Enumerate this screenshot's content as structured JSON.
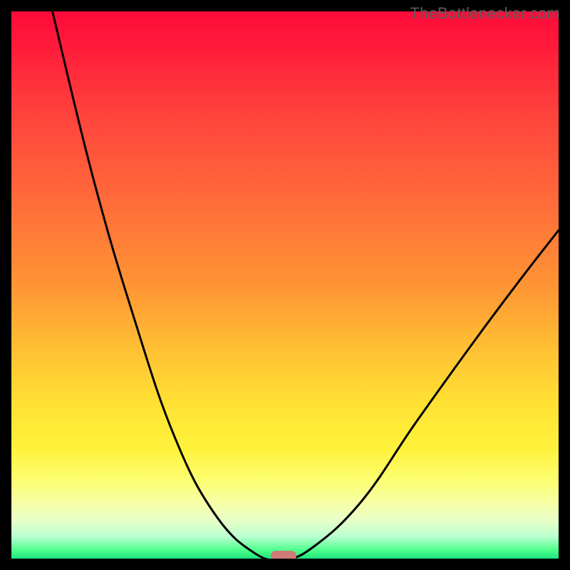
{
  "attribution": "TheBottlenecker.com",
  "chart_data": {
    "type": "line",
    "title": "",
    "xlabel": "",
    "ylabel": "",
    "xlim": [
      0,
      1
    ],
    "ylim": [
      0,
      100
    ],
    "series": [
      {
        "name": "curve-left",
        "x": [
          0.075,
          0.149,
          0.224,
          0.298,
          0.372,
          0.446,
          0.498
        ],
        "values": [
          100,
          69.7,
          44.0,
          22.3,
          8.1,
          0.9,
          0.0
        ]
      },
      {
        "name": "curve-right",
        "x": [
          0.498,
          0.55,
          0.64,
          0.74,
          0.85,
          0.93,
          1.0
        ],
        "values": [
          0.0,
          2.0,
          10.5,
          25.0,
          40.3,
          51.0,
          60.0
        ]
      }
    ],
    "gradient_colors": [
      "#ff0a3a",
      "#ff6a3a",
      "#ffc133",
      "#fdff74",
      "#4dff8a",
      "#1de480"
    ],
    "marker": {
      "x": 0.498,
      "y": 0.0,
      "color": "#cf7a76"
    }
  }
}
